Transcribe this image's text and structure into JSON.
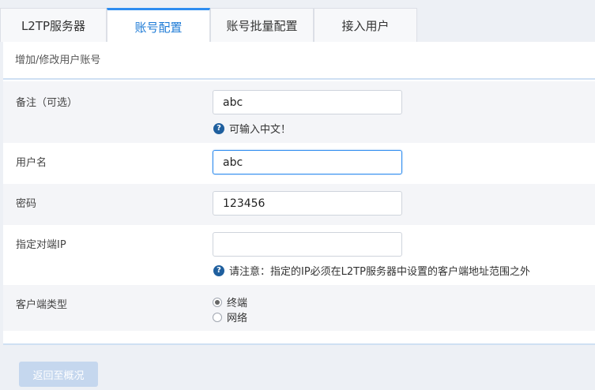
{
  "tabs": [
    {
      "label": "L2TP服务器",
      "active": false
    },
    {
      "label": "账号配置",
      "active": true
    },
    {
      "label": "账号批量配置",
      "active": false
    },
    {
      "label": "接入用户",
      "active": false
    }
  ],
  "panel": {
    "title": "增加/修改用户账号"
  },
  "form": {
    "remark": {
      "label": "备注（可选）",
      "value": "abc",
      "hint": "可输入中文！"
    },
    "username": {
      "label": "用户名",
      "value": "abc"
    },
    "password": {
      "label": "密码",
      "value": "123456"
    },
    "peer_ip": {
      "label": "指定对端IP",
      "value": "",
      "hint": "请注意：指定的IP必须在L2TP服务器中设置的客户端地址范围之外"
    },
    "client_type": {
      "label": "客户端类型",
      "options": [
        {
          "label": "终端",
          "checked": true
        },
        {
          "label": "网络",
          "checked": false
        }
      ]
    }
  },
  "footer": {
    "back_label": "返回至概况"
  },
  "icons": {
    "hint_icon": "question-circle-icon",
    "hint_icon_glyph": "?"
  },
  "colors": {
    "accent": "#2d8cf0",
    "background": "#edf0f5",
    "back_button": "#c5d7ee"
  }
}
